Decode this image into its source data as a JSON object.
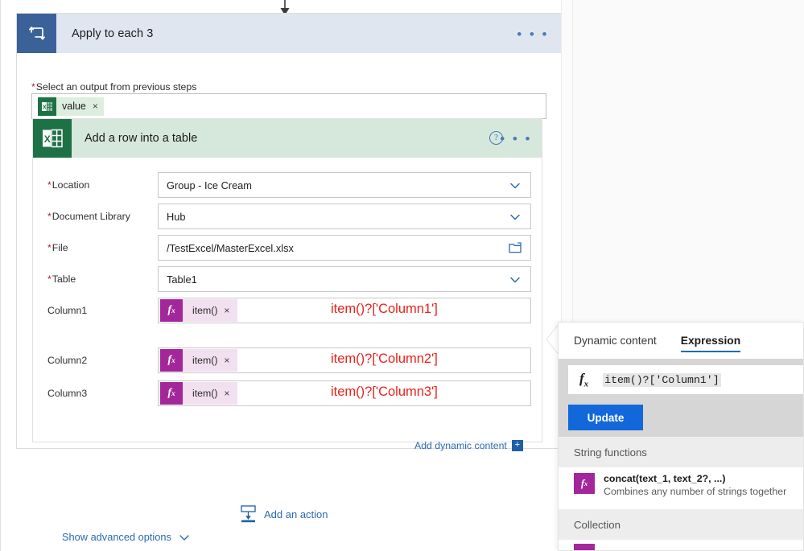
{
  "canvas": {
    "loop_card": {
      "icon": "loop-icon",
      "title": "Apply to each 3",
      "overflow_label": "• • •",
      "field_label": "Select an output from previous steps",
      "required": true,
      "token": {
        "icon": "excel-icon",
        "label": "value",
        "remove": "×"
      }
    },
    "excel_card": {
      "icon": "excel-icon",
      "title": "Add a row into a table",
      "help_label": "?",
      "overflow_label": "• • •",
      "fields": [
        {
          "label": "Location",
          "required": true,
          "value": "Group - Ice Cream",
          "control": "dropdown"
        },
        {
          "label": "Document Library",
          "required": true,
          "value": "Hub",
          "control": "dropdown"
        },
        {
          "label": "File",
          "required": true,
          "value": "/TestExcel/MasterExcel.xlsx",
          "control": "filepicker"
        },
        {
          "label": "Table",
          "required": true,
          "value": "Table1",
          "control": "dropdown"
        }
      ],
      "columns": [
        {
          "label": "Column1",
          "token": "item()",
          "remove": "×",
          "annotation": "item()?['Column1']"
        },
        {
          "label": "Column2",
          "token": "item()",
          "remove": "×",
          "annotation": "item()?['Column2']"
        },
        {
          "label": "Column3",
          "token": "item()",
          "remove": "×",
          "annotation": "item()?['Column3']"
        }
      ],
      "add_dynamic_content": {
        "label": "Add dynamic content",
        "button_glyph": "+"
      },
      "show_advanced": {
        "label": "Show advanced options",
        "chevron": "chevron-down-icon"
      }
    },
    "add_action": {
      "label": "Add an action",
      "icon": "add-action-icon"
    }
  },
  "flyout": {
    "tabs": [
      {
        "label": "Dynamic content",
        "active": false
      },
      {
        "label": "Expression",
        "active": true
      }
    ],
    "expression_input": {
      "fx": "fx",
      "value": "item()?['Column1']"
    },
    "update_button": "Update",
    "sections": [
      {
        "title": "String functions",
        "items": [
          {
            "signature": "concat(text_1, text_2?, ...)",
            "description": "Combines any number of strings together"
          }
        ]
      },
      {
        "title": "Collection",
        "items": [
          {
            "signature": "",
            "description": ""
          }
        ]
      }
    ]
  },
  "colors": {
    "loop_header": "#dfe6f0",
    "loop_icon": "#3b6298",
    "excel_header": "#d6e8dc",
    "excel_icon": "#1e7145",
    "fx_token": "#a4269b",
    "fx_token_bg": "#f2dff0",
    "annotation_red": "#e8231b",
    "link_blue": "#2a6ab0",
    "update_blue": "#1268da",
    "tab_underline": "#0f6cbd"
  }
}
